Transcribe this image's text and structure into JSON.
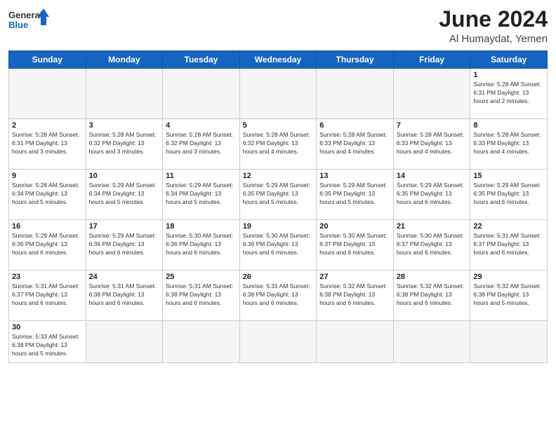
{
  "header": {
    "logo_line1": "General",
    "logo_line2": "Blue",
    "title": "June 2024",
    "subtitle": "Al Humaydat, Yemen"
  },
  "days_of_week": [
    "Sunday",
    "Monday",
    "Tuesday",
    "Wednesday",
    "Thursday",
    "Friday",
    "Saturday"
  ],
  "weeks": [
    [
      {
        "day": "",
        "info": ""
      },
      {
        "day": "",
        "info": ""
      },
      {
        "day": "",
        "info": ""
      },
      {
        "day": "",
        "info": ""
      },
      {
        "day": "",
        "info": ""
      },
      {
        "day": "",
        "info": ""
      },
      {
        "day": "1",
        "info": "Sunrise: 5:28 AM\nSunset: 6:31 PM\nDaylight: 13 hours and 2 minutes."
      }
    ],
    [
      {
        "day": "2",
        "info": "Sunrise: 5:28 AM\nSunset: 6:31 PM\nDaylight: 13 hours and 3 minutes."
      },
      {
        "day": "3",
        "info": "Sunrise: 5:28 AM\nSunset: 6:32 PM\nDaylight: 13 hours and 3 minutes."
      },
      {
        "day": "4",
        "info": "Sunrise: 5:28 AM\nSunset: 6:32 PM\nDaylight: 13 hours and 3 minutes."
      },
      {
        "day": "5",
        "info": "Sunrise: 5:28 AM\nSunset: 6:32 PM\nDaylight: 13 hours and 4 minutes."
      },
      {
        "day": "6",
        "info": "Sunrise: 5:28 AM\nSunset: 6:33 PM\nDaylight: 13 hours and 4 minutes."
      },
      {
        "day": "7",
        "info": "Sunrise: 5:28 AM\nSunset: 6:33 PM\nDaylight: 13 hours and 4 minutes."
      },
      {
        "day": "8",
        "info": "Sunrise: 5:28 AM\nSunset: 6:33 PM\nDaylight: 13 hours and 4 minutes."
      }
    ],
    [
      {
        "day": "9",
        "info": "Sunrise: 5:28 AM\nSunset: 6:34 PM\nDaylight: 13 hours and 5 minutes."
      },
      {
        "day": "10",
        "info": "Sunrise: 5:29 AM\nSunset: 6:34 PM\nDaylight: 13 hours and 5 minutes."
      },
      {
        "day": "11",
        "info": "Sunrise: 5:29 AM\nSunset: 6:34 PM\nDaylight: 13 hours and 5 minutes."
      },
      {
        "day": "12",
        "info": "Sunrise: 5:29 AM\nSunset: 6:35 PM\nDaylight: 13 hours and 5 minutes."
      },
      {
        "day": "13",
        "info": "Sunrise: 5:29 AM\nSunset: 6:35 PM\nDaylight: 13 hours and 5 minutes."
      },
      {
        "day": "14",
        "info": "Sunrise: 5:29 AM\nSunset: 6:35 PM\nDaylight: 13 hours and 6 minutes."
      },
      {
        "day": "15",
        "info": "Sunrise: 5:29 AM\nSunset: 6:35 PM\nDaylight: 13 hours and 6 minutes."
      }
    ],
    [
      {
        "day": "16",
        "info": "Sunrise: 5:29 AM\nSunset: 6:36 PM\nDaylight: 13 hours and 6 minutes."
      },
      {
        "day": "17",
        "info": "Sunrise: 5:29 AM\nSunset: 6:36 PM\nDaylight: 13 hours and 6 minutes."
      },
      {
        "day": "18",
        "info": "Sunrise: 5:30 AM\nSunset: 6:36 PM\nDaylight: 13 hours and 6 minutes."
      },
      {
        "day": "19",
        "info": "Sunrise: 5:30 AM\nSunset: 6:36 PM\nDaylight: 13 hours and 6 minutes."
      },
      {
        "day": "20",
        "info": "Sunrise: 5:30 AM\nSunset: 6:37 PM\nDaylight: 13 hours and 6 minutes."
      },
      {
        "day": "21",
        "info": "Sunrise: 5:30 AM\nSunset: 6:37 PM\nDaylight: 13 hours and 6 minutes."
      },
      {
        "day": "22",
        "info": "Sunrise: 5:31 AM\nSunset: 6:37 PM\nDaylight: 13 hours and 6 minutes."
      }
    ],
    [
      {
        "day": "23",
        "info": "Sunrise: 5:31 AM\nSunset: 6:37 PM\nDaylight: 13 hours and 6 minutes."
      },
      {
        "day": "24",
        "info": "Sunrise: 5:31 AM\nSunset: 6:38 PM\nDaylight: 13 hours and 6 minutes."
      },
      {
        "day": "25",
        "info": "Sunrise: 5:31 AM\nSunset: 6:38 PM\nDaylight: 13 hours and 6 minutes."
      },
      {
        "day": "26",
        "info": "Sunrise: 5:31 AM\nSunset: 6:38 PM\nDaylight: 13 hours and 6 minutes."
      },
      {
        "day": "27",
        "info": "Sunrise: 5:32 AM\nSunset: 6:38 PM\nDaylight: 13 hours and 6 minutes."
      },
      {
        "day": "28",
        "info": "Sunrise: 5:32 AM\nSunset: 6:38 PM\nDaylight: 13 hours and 6 minutes."
      },
      {
        "day": "29",
        "info": "Sunrise: 5:32 AM\nSunset: 6:38 PM\nDaylight: 13 hours and 5 minutes."
      }
    ],
    [
      {
        "day": "30",
        "info": "Sunrise: 5:33 AM\nSunset: 6:38 PM\nDaylight: 13 hours and 5 minutes."
      },
      {
        "day": "",
        "info": ""
      },
      {
        "day": "",
        "info": ""
      },
      {
        "day": "",
        "info": ""
      },
      {
        "day": "",
        "info": ""
      },
      {
        "day": "",
        "info": ""
      },
      {
        "day": "",
        "info": ""
      }
    ]
  ]
}
